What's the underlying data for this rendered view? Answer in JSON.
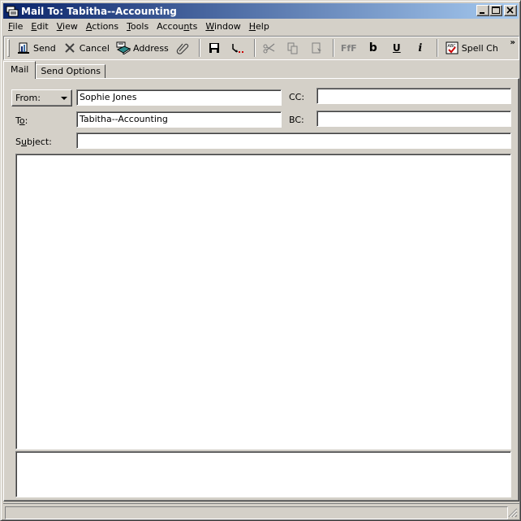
{
  "window": {
    "title": "Mail To: Tabitha--Accounting",
    "controls": {
      "minimize": "_",
      "maximize": "□",
      "close": "✕"
    }
  },
  "menubar": {
    "items": [
      {
        "label": "File",
        "accel": "F"
      },
      {
        "label": "Edit",
        "accel": "E"
      },
      {
        "label": "View",
        "accel": "V"
      },
      {
        "label": "Actions",
        "accel": "A"
      },
      {
        "label": "Tools",
        "accel": "T"
      },
      {
        "label": "Accounts",
        "accel": "n"
      },
      {
        "label": "Window",
        "accel": "W"
      },
      {
        "label": "Help",
        "accel": "H"
      }
    ]
  },
  "toolbar": {
    "send": "Send",
    "cancel": "Cancel",
    "address": "Address",
    "spell": "Spell Ch",
    "overflow": "»",
    "icons": [
      "send-icon",
      "cancel-icon",
      "address-book-icon",
      "attach-icon",
      "save-icon",
      "insert-icon",
      "cut-icon",
      "copy-icon",
      "paste-icon",
      "font-icon",
      "bold-icon",
      "underline-icon",
      "italic-icon",
      "spell-check-icon"
    ]
  },
  "tabs": [
    {
      "label": "Mail",
      "active": true
    },
    {
      "label": "Send Options",
      "active": false
    }
  ],
  "form": {
    "from_label": "From:",
    "from_value": "Sophie Jones",
    "to_label": "To:",
    "to_value": "Tabitha--Accounting",
    "cc_label": "CC:",
    "cc_value": "",
    "bc_label": "BC:",
    "bc_value": "",
    "subject_label": "Subject:",
    "subject_value": "",
    "body": "",
    "signature": ""
  },
  "status": {
    "text": ""
  }
}
